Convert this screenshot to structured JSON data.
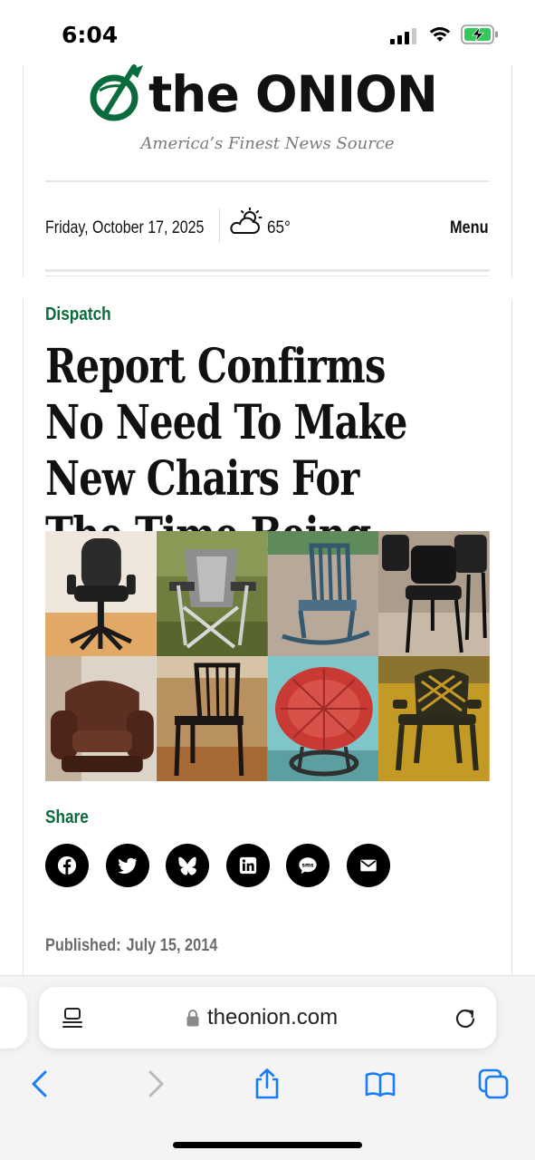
{
  "status_bar": {
    "time": "6:04",
    "icons": [
      "cellular-signal-icon",
      "wifi-icon",
      "battery-charging-icon"
    ]
  },
  "masthead": {
    "logo_text": "the ONION",
    "tagline": "America’s Finest News Source",
    "date": "Friday, October 17, 2025",
    "weather_icon": "partly-sunny-icon",
    "temperature": "65°",
    "menu_label": "Menu",
    "brand_color": "#0a6b3c"
  },
  "article": {
    "section": "Dispatch",
    "headline": "Report Confirms No Need To Make New Chairs For The Time Being",
    "image_tiles": [
      "office chair",
      "folding camp chair",
      "rocking chair",
      "stacking chairs",
      "leather armchair",
      "wooden dining chair",
      "papasan chair",
      "plastic lawn chair"
    ],
    "share_label": "Share",
    "share_buttons": [
      "facebook-icon",
      "twitter-icon",
      "bluesky-icon",
      "linkedin-icon",
      "sms-icon",
      "email-icon"
    ],
    "published_label": "Published:",
    "published_date": "July 15, 2014"
  },
  "browser": {
    "url": "theonion.com",
    "accent_color": "#1a7cf5",
    "icons": [
      "reader-mode-icon",
      "lock-icon",
      "reload-icon",
      "back-icon",
      "forward-icon",
      "share-icon",
      "bookmarks-icon",
      "tabs-icon"
    ]
  }
}
